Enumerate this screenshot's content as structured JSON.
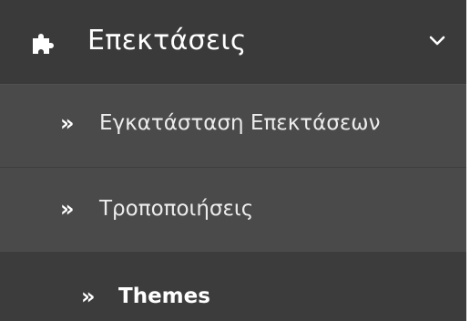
{
  "menu": {
    "header": {
      "title": "Επεκτάσεις",
      "icon": "puzzle-icon",
      "toggle_icon": "chevron-down-icon",
      "background": "#3a3a3a"
    },
    "items": [
      {
        "bullet": "»",
        "label": "Εγκατάσταση Επεκτάσεων"
      },
      {
        "bullet": "»",
        "label": "Τροποποιήσεις"
      },
      {
        "bullet": "»",
        "label": "Themes",
        "active": true
      }
    ],
    "colors": {
      "submenu_background": "#4a4a4a",
      "active_background": "#3c3c3c",
      "text": "#ffffff"
    }
  }
}
